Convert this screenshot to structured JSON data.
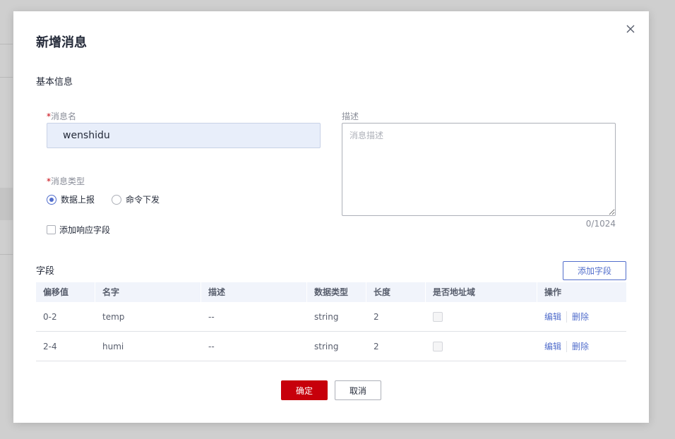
{
  "dialog": {
    "title": "新增消息",
    "basic_section": "基本信息",
    "name_required_mark": "*",
    "name_label": "消息名",
    "name_value": "wenshidu",
    "desc_label": "描述",
    "desc_placeholder": "消息描述",
    "desc_counter": "0/1024",
    "type_required_mark": "*",
    "type_label": "消息类型",
    "type_options": [
      {
        "label": "数据上报",
        "selected": true
      },
      {
        "label": "命令下发",
        "selected": false
      }
    ],
    "response_checkbox_label": "添加响应字段",
    "fields_section": "字段",
    "add_field_label": "添加字段",
    "table": {
      "headers": [
        "偏移值",
        "名字",
        "描述",
        "数据类型",
        "长度",
        "是否地址域",
        "操作"
      ],
      "rows": [
        {
          "offset": "0-2",
          "name": "temp",
          "desc": "--",
          "type": "string",
          "length": "2",
          "edit": "编辑",
          "delete": "删除"
        },
        {
          "offset": "2-4",
          "name": "humi",
          "desc": "--",
          "type": "string",
          "length": "2",
          "edit": "编辑",
          "delete": "删除"
        }
      ]
    },
    "ok_label": "确定",
    "cancel_label": "取消"
  },
  "colors": {
    "primary_red": "#c7000b",
    "link_blue": "#526ecc",
    "header_bg": "#f1f4fb"
  },
  "icons": {
    "close": "close-icon"
  }
}
